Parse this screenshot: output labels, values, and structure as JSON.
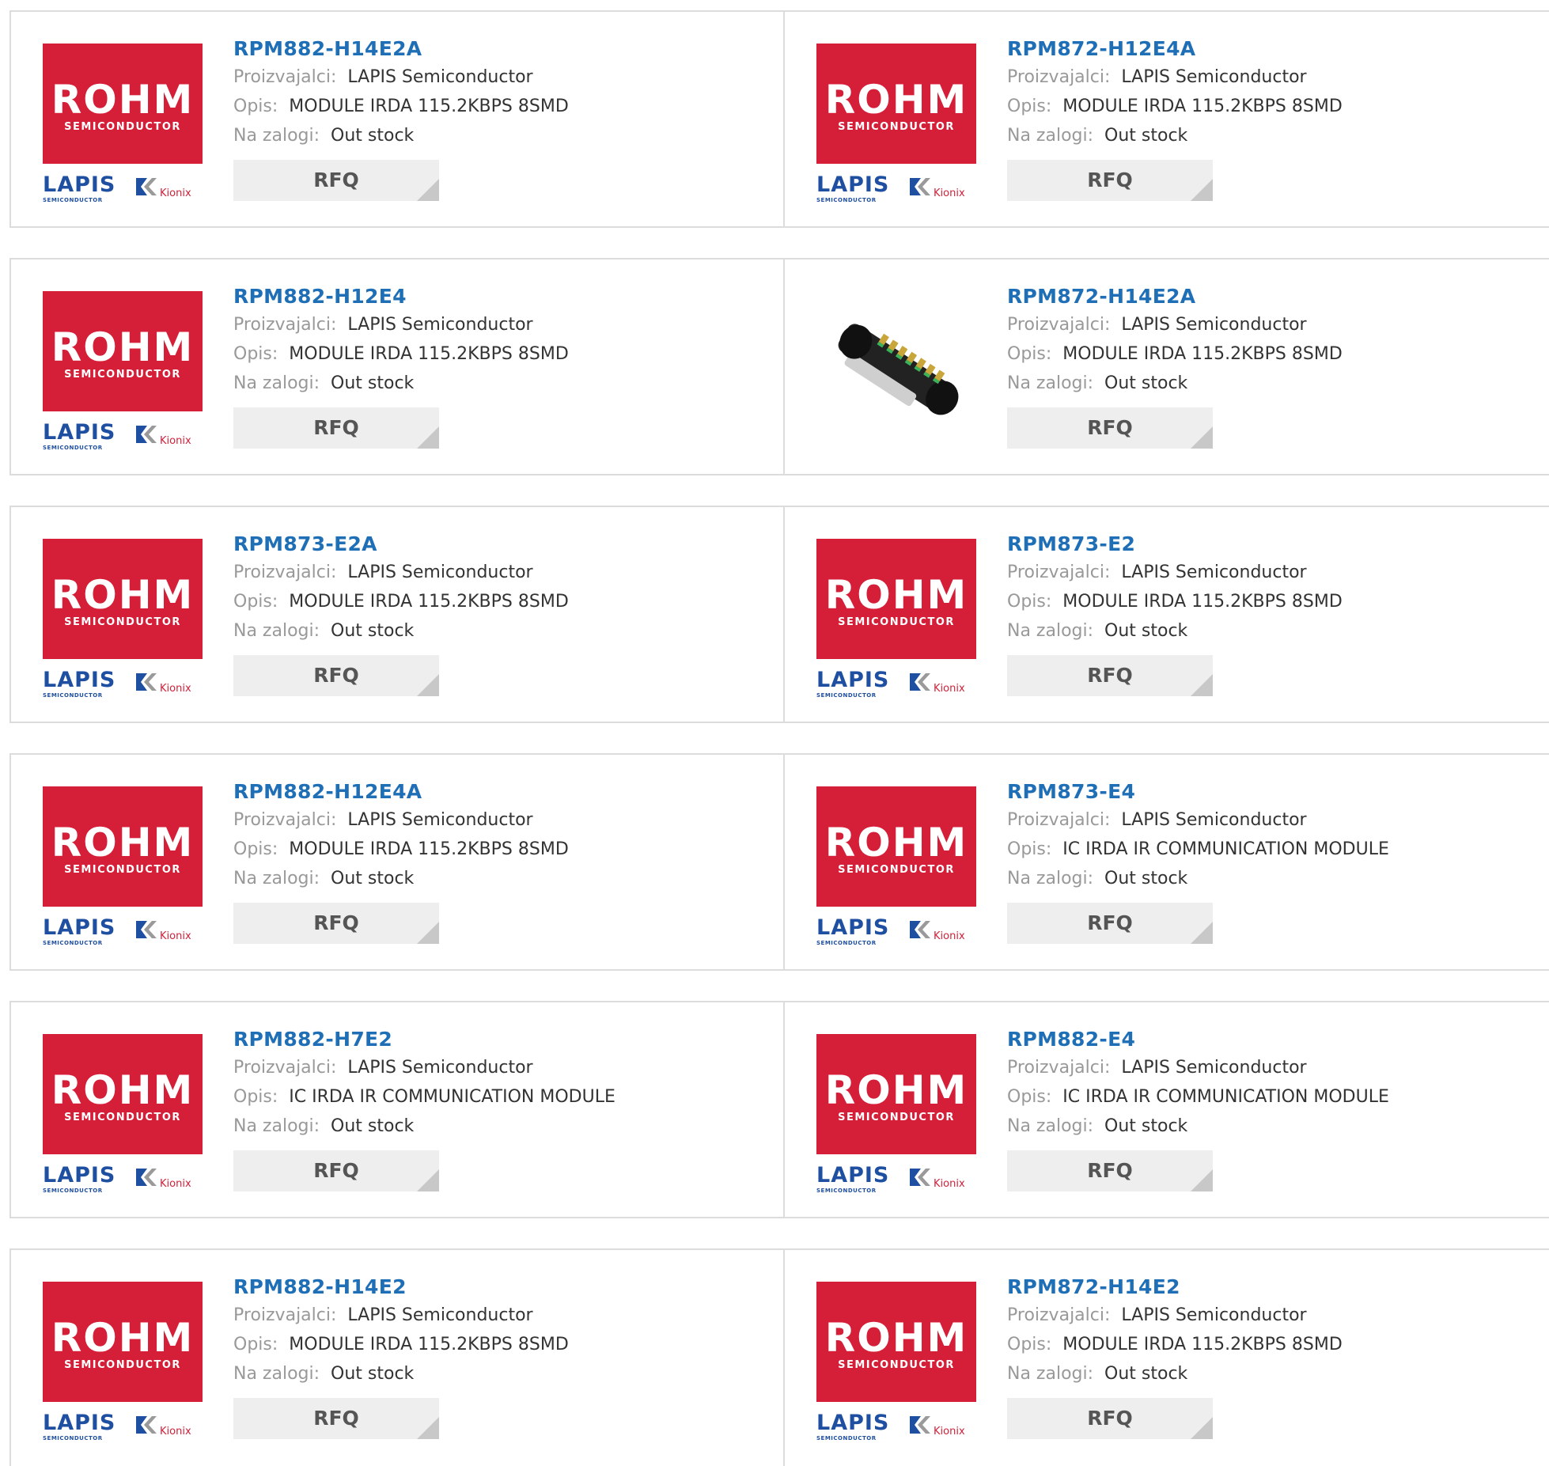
{
  "labels": {
    "manufacturer": "Proizvajalci:",
    "description": "Opis:",
    "stock": "Na zalogi:",
    "rfq": "RFQ"
  },
  "logo": {
    "rohm": "ROHM",
    "rohm_sub": "SEMICONDUCTOR",
    "lapis": "LAPIS",
    "lapis_sub": "SEMICONDUCTOR",
    "kionix": "Kionix"
  },
  "colors": {
    "title": "#1f6fb7",
    "rohm_red": "#d51f38",
    "button_bg": "#eeeeee"
  },
  "products": [
    {
      "name": "RPM882-H14E2A",
      "manufacturer": "LAPIS Semiconductor",
      "description": "MODULE IRDA 115.2KBPS 8SMD",
      "stock": "Out stock",
      "image": "rohm-logo"
    },
    {
      "name": "RPM872-H12E4A",
      "manufacturer": "LAPIS Semiconductor",
      "description": "MODULE IRDA 115.2KBPS 8SMD",
      "stock": "Out stock",
      "image": "rohm-logo"
    },
    {
      "name": "RPM882-H12E4",
      "manufacturer": "LAPIS Semiconductor",
      "description": "MODULE IRDA 115.2KBPS 8SMD",
      "stock": "Out stock",
      "image": "rohm-logo"
    },
    {
      "name": "RPM872-H14E2A",
      "manufacturer": "LAPIS Semiconductor",
      "description": "MODULE IRDA 115.2KBPS 8SMD",
      "stock": "Out stock",
      "image": "component-photo"
    },
    {
      "name": "RPM873-E2A",
      "manufacturer": "LAPIS Semiconductor",
      "description": "MODULE IRDA 115.2KBPS 8SMD",
      "stock": "Out stock",
      "image": "rohm-logo"
    },
    {
      "name": "RPM873-E2",
      "manufacturer": "LAPIS Semiconductor",
      "description": "MODULE IRDA 115.2KBPS 8SMD",
      "stock": "Out stock",
      "image": "rohm-logo"
    },
    {
      "name": "RPM882-H12E4A",
      "manufacturer": "LAPIS Semiconductor",
      "description": "MODULE IRDA 115.2KBPS 8SMD",
      "stock": "Out stock",
      "image": "rohm-logo"
    },
    {
      "name": "RPM873-E4",
      "manufacturer": "LAPIS Semiconductor",
      "description": "IC IRDA IR COMMUNICATION MODULE",
      "stock": "Out stock",
      "image": "rohm-logo"
    },
    {
      "name": "RPM882-H7E2",
      "manufacturer": "LAPIS Semiconductor",
      "description": "IC IRDA IR COMMUNICATION MODULE",
      "stock": "Out stock",
      "image": "rohm-logo"
    },
    {
      "name": "RPM882-E4",
      "manufacturer": "LAPIS Semiconductor",
      "description": "IC IRDA IR COMMUNICATION MODULE",
      "stock": "Out stock",
      "image": "rohm-logo"
    },
    {
      "name": "RPM882-H14E2",
      "manufacturer": "LAPIS Semiconductor",
      "description": "MODULE IRDA 115.2KBPS 8SMD",
      "stock": "Out stock",
      "image": "rohm-logo"
    },
    {
      "name": "RPM872-H14E2",
      "manufacturer": "LAPIS Semiconductor",
      "description": "MODULE IRDA 115.2KBPS 8SMD",
      "stock": "Out stock",
      "image": "rohm-logo"
    }
  ]
}
